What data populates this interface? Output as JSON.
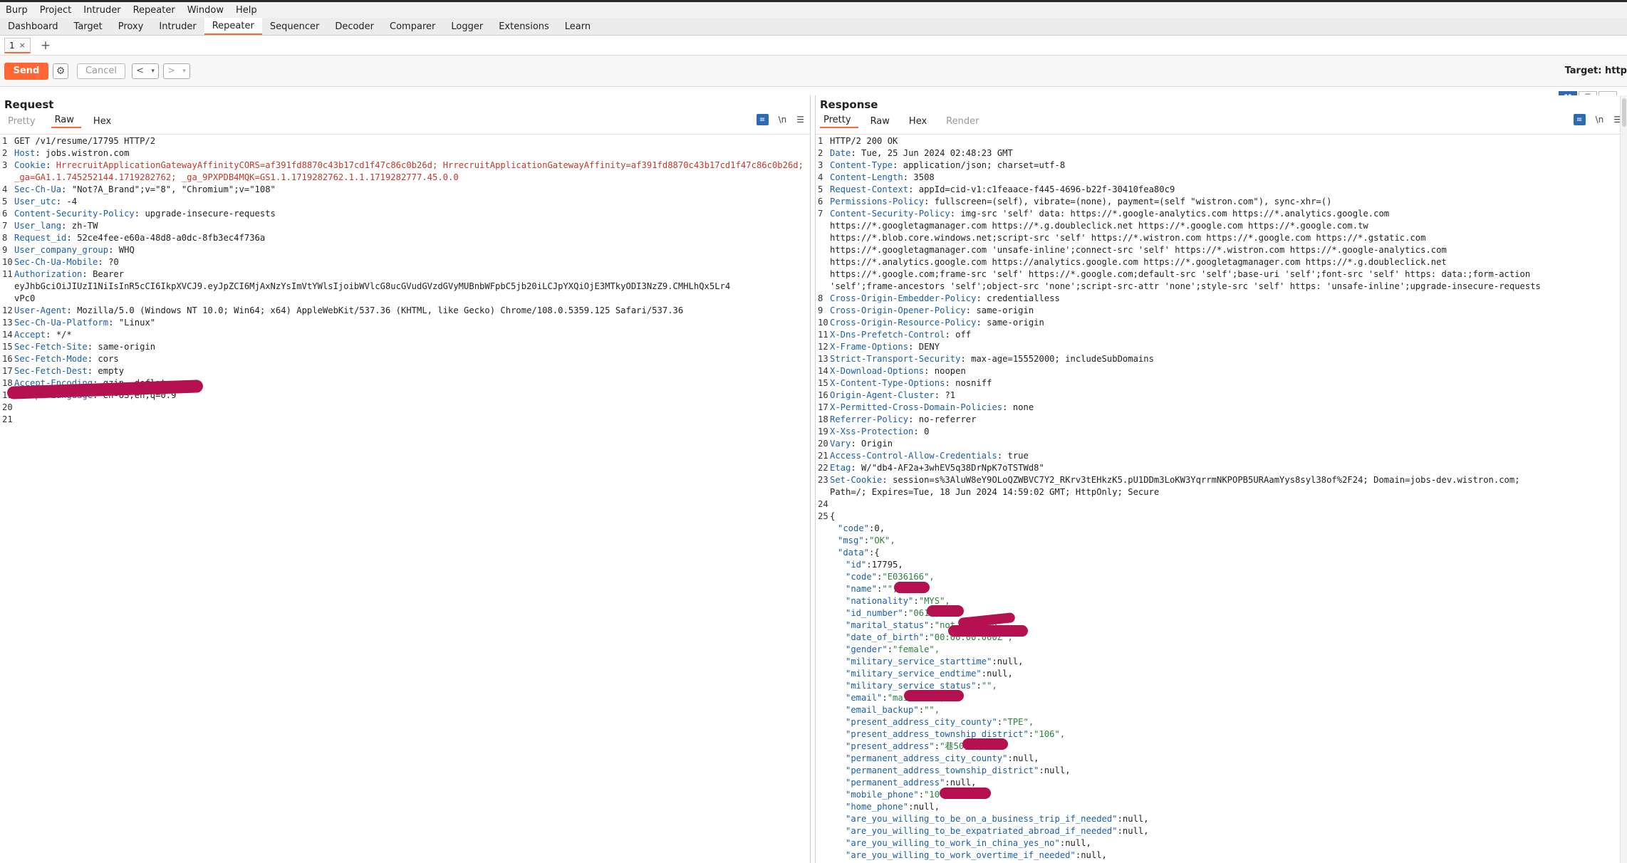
{
  "menu": [
    "Burp",
    "Project",
    "Intruder",
    "Repeater",
    "Window",
    "Help"
  ],
  "tool_tabs": [
    "Dashboard",
    "Target",
    "Proxy",
    "Intruder",
    "Repeater",
    "Sequencer",
    "Decoder",
    "Comparer",
    "Logger",
    "Extensions",
    "Learn"
  ],
  "active_tool_tab": "Repeater",
  "subtab": {
    "label": "1",
    "close": "×",
    "add": "+"
  },
  "toolbar": {
    "send": "Send",
    "cancel": "Cancel",
    "back": "<",
    "forward": ">",
    "dropdown": "▾",
    "target_label": "Target: http"
  },
  "request": {
    "title": "Request",
    "tabs": [
      "Pretty",
      "Raw",
      "Hex"
    ],
    "active_tab": "Raw",
    "lines": [
      {
        "n": "1",
        "k": "",
        "v": "GET /v1/resume/17795 HTTP/2"
      },
      {
        "n": "2",
        "k": "Host",
        "v": "jobs.wistron.com"
      },
      {
        "n": "3",
        "k": "Cookie",
        "v": "HrrecruitApplicationGatewayAffinityCORS=af391fd8870c43b17cd1f47c86c0b26d; HrrecruitApplicationGatewayAffinity=af391fd8870c43b17cd1f47c86c0b26d; _ga=GA1.1.745252144.1719282762; _ga_9PXPDB4MQK=GS1.1.1719282762.1.1.1719282777.45.0.0"
      },
      {
        "n": "4",
        "k": "Sec-Ch-Ua",
        "v": "\"Not?A_Brand\";v=\"8\", \"Chromium\";v=\"108\""
      },
      {
        "n": "5",
        "k": "User_utc",
        "v": "-4"
      },
      {
        "n": "6",
        "k": "Content-Security-Policy",
        "v": "upgrade-insecure-requests"
      },
      {
        "n": "7",
        "k": "User_lang",
        "v": "zh-TW"
      },
      {
        "n": "8",
        "k": "Request_id",
        "v": "52ce4fee-e60a-48d8-a0dc-8fb3ec4f736a"
      },
      {
        "n": "9",
        "k": "User_company_group",
        "v": "WHQ"
      },
      {
        "n": "10",
        "k": "Sec-Ch-Ua-Mobile",
        "v": "?0"
      },
      {
        "n": "11",
        "k": "Authorization",
        "v": "Bearer\neyJhbGciOiJIUzI1NiIsInR5cCI6IkpXVCJ9.eyJpZCI6MjAxNzYsImVtYWlsIjoibWVlcG8ucGVudGVzdGVyMUBnbWFpbC5jb20iLCJpYXQiOjE3MTkyODI3NzZ9.CMHLhQx5Lr4\nvPc0"
      },
      {
        "n": "12",
        "k": "User-Agent",
        "v": "Mozilla/5.0 (Windows NT 10.0; Win64; x64) AppleWebKit/537.36 (KHTML, like Gecko) Chrome/108.0.5359.125 Safari/537.36"
      },
      {
        "n": "13",
        "k": "Sec-Ch-Ua-Platform",
        "v": "\"Linux\""
      },
      {
        "n": "14",
        "k": "Accept",
        "v": "*/*"
      },
      {
        "n": "15",
        "k": "Sec-Fetch-Site",
        "v": "same-origin"
      },
      {
        "n": "16",
        "k": "Sec-Fetch-Mode",
        "v": "cors"
      },
      {
        "n": "17",
        "k": "Sec-Fetch-Dest",
        "v": "empty"
      },
      {
        "n": "18",
        "k": "Accept-Encoding",
        "v": "gzip, deflate"
      },
      {
        "n": "19",
        "k": "Accept-Language",
        "v": "en-US,en;q=0.9"
      },
      {
        "n": "20",
        "k": "",
        "v": ""
      },
      {
        "n": "21",
        "k": "",
        "v": ""
      }
    ]
  },
  "response": {
    "title": "Response",
    "tabs": [
      "Pretty",
      "Raw",
      "Hex",
      "Render"
    ],
    "active_tab": "Pretty",
    "header_lines": [
      {
        "n": "1",
        "k": "",
        "v": "HTTP/2 200 OK"
      },
      {
        "n": "2",
        "k": "Date",
        "v": "Tue, 25 Jun 2024 02:48:23 GMT"
      },
      {
        "n": "3",
        "k": "Content-Type",
        "v": "application/json; charset=utf-8"
      },
      {
        "n": "4",
        "k": "Content-Length",
        "v": "3508"
      },
      {
        "n": "5",
        "k": "Request-Context",
        "v": "appId=cid-v1:c1feaace-f445-4696-b22f-30410fea80c9"
      },
      {
        "n": "6",
        "k": "Permissions-Policy",
        "v": "fullscreen=(self), vibrate=(none), payment=(self \"wistron.com\"), sync-xhr=()"
      },
      {
        "n": "7",
        "k": "Content-Security-Policy",
        "v": "img-src 'self' data: https://*.google-analytics.com https://*.analytics.google.com\nhttps://*.googletagmanager.com https://*.g.doubleclick.net https://*.google.com https://*.google.com.tw\nhttps://*.blob.core.windows.net;script-src 'self' https://*.wistron.com https://*.google.com https://*.gstatic.com\nhttps://*.googletagmanager.com 'unsafe-inline';connect-src 'self' https://*.wistron.com https://*.google-analytics.com\nhttps://*.analytics.google.com https://analytics.google.com https://*.googletagmanager.com https://*.g.doubleclick.net\nhttps://*.google.com;frame-src 'self' https://*.google.com;default-src 'self';base-uri 'self';font-src 'self' https: data:;form-action\n'self';frame-ancestors 'self';object-src 'none';script-src-attr 'none';style-src 'self' https: 'unsafe-inline';upgrade-insecure-requests"
      },
      {
        "n": "8",
        "k": "Cross-Origin-Embedder-Policy",
        "v": "credentialless"
      },
      {
        "n": "9",
        "k": "Cross-Origin-Opener-Policy",
        "v": "same-origin"
      },
      {
        "n": "10",
        "k": "Cross-Origin-Resource-Policy",
        "v": "same-origin"
      },
      {
        "n": "11",
        "k": "X-Dns-Prefetch-Control",
        "v": "off"
      },
      {
        "n": "12",
        "k": "X-Frame-Options",
        "v": "DENY"
      },
      {
        "n": "13",
        "k": "Strict-Transport-Security",
        "v": "max-age=15552000; includeSubDomains"
      },
      {
        "n": "14",
        "k": "X-Download-Options",
        "v": "noopen"
      },
      {
        "n": "15",
        "k": "X-Content-Type-Options",
        "v": "nosniff"
      },
      {
        "n": "16",
        "k": "Origin-Agent-Cluster",
        "v": "?1"
      },
      {
        "n": "17",
        "k": "X-Permitted-Cross-Domain-Policies",
        "v": "none"
      },
      {
        "n": "18",
        "k": "Referrer-Policy",
        "v": "no-referrer"
      },
      {
        "n": "19",
        "k": "X-Xss-Protection",
        "v": "0"
      },
      {
        "n": "20",
        "k": "Vary",
        "v": "Origin"
      },
      {
        "n": "21",
        "k": "Access-Control-Allow-Credentials",
        "v": "true"
      },
      {
        "n": "22",
        "k": "Etag",
        "v": "W/\"db4-AF2a+3whEV5q38DrNpK7oTSTWd8\""
      },
      {
        "n": "23",
        "k": "Set-Cookie",
        "v": "session=s%3AluW8eY9OLoQZWBVC7Y2_RKrv3tEHkzK5.pU1DDm3LoKW3YqrrmNKPOPB5URAamYys8syl38of%2F24; Domain=jobs-dev.wistron.com;\nPath=/; Expires=Tue, 18 Jun 2024 14:59:02 GMT; HttpOnly; Secure"
      },
      {
        "n": "24",
        "k": "",
        "v": ""
      },
      {
        "n": "25",
        "k": "",
        "v": "{"
      }
    ],
    "json_lines": [
      {
        "indent": 1,
        "k": "\"code\"",
        "v": "0,"
      },
      {
        "indent": 1,
        "k": "\"msg\"",
        "v": "\"OK\","
      },
      {
        "indent": 1,
        "k": "\"data\"",
        "v": "{"
      },
      {
        "indent": 2,
        "k": "\"id\"",
        "v": "17795,"
      },
      {
        "indent": 2,
        "k": "\"code\"",
        "v": "\"E036166\","
      },
      {
        "indent": 2,
        "k": "\"name\"",
        "v": "\"\","
      },
      {
        "indent": 2,
        "k": "\"nationality\"",
        "v": "\"MYS\","
      },
      {
        "indent": 2,
        "k": "\"id_number\"",
        "v": "\"061\","
      },
      {
        "indent": 2,
        "k": "\"marital_status\"",
        "v": "\"not-married\","
      },
      {
        "indent": 2,
        "k": "\"date_of_birth\"",
        "v": "\"00:00:00.000Z\","
      },
      {
        "indent": 2,
        "k": "\"gender\"",
        "v": "\"female\","
      },
      {
        "indent": 2,
        "k": "\"military_service_starttime\"",
        "v": "null,"
      },
      {
        "indent": 2,
        "k": "\"military_service_endtime\"",
        "v": "null,"
      },
      {
        "indent": 2,
        "k": "\"military_service_status\"",
        "v": "\"\","
      },
      {
        "indent": 2,
        "k": "\"email\"",
        "v": "\"mail.com\","
      },
      {
        "indent": 2,
        "k": "\"email_backup\"",
        "v": "\"\","
      },
      {
        "indent": 2,
        "k": "\"present_address_city_county\"",
        "v": "\"TPE\","
      },
      {
        "indent": 2,
        "k": "\"present_address_township_district\"",
        "v": "\"106\","
      },
      {
        "indent": 2,
        "k": "\"present_address\"",
        "v": "\"巷50號\","
      },
      {
        "indent": 2,
        "k": "\"permanent_address_city_county\"",
        "v": "null,"
      },
      {
        "indent": 2,
        "k": "\"permanent_address_township_district\"",
        "v": "null,"
      },
      {
        "indent": 2,
        "k": "\"permanent_address\"",
        "v": "null,"
      },
      {
        "indent": 2,
        "k": "\"mobile_phone\"",
        "v": "\"10\","
      },
      {
        "indent": 2,
        "k": "\"home_phone\"",
        "v": "null,"
      },
      {
        "indent": 2,
        "k": "\"are_you_willing_to_be_on_a_business_trip_if_needed\"",
        "v": "null,"
      },
      {
        "indent": 2,
        "k": "\"are_you_willing_to_be_expatriated_abroad_if_needed\"",
        "v": "null,"
      },
      {
        "indent": 2,
        "k": "\"are_you_willing_to_work_in_china_yes_no\"",
        "v": "null,"
      },
      {
        "indent": 2,
        "k": "\"are_you_willing_to_work_overtime_if_needed\"",
        "v": "null,"
      }
    ]
  },
  "colors": {
    "accent": "#ff6633",
    "header_key": "#1b5fa8",
    "cookie_value": "#c0392b",
    "json_string": "#2a7f3f",
    "redaction": "#b5104f",
    "active_blue": "#2a6bb3"
  },
  "icons": [
    "gear-icon",
    "wrap-icon",
    "newline-icon",
    "menu-icon",
    "layout-split-icon",
    "layout-horizontal-icon",
    "layout-tabs-icon"
  ]
}
